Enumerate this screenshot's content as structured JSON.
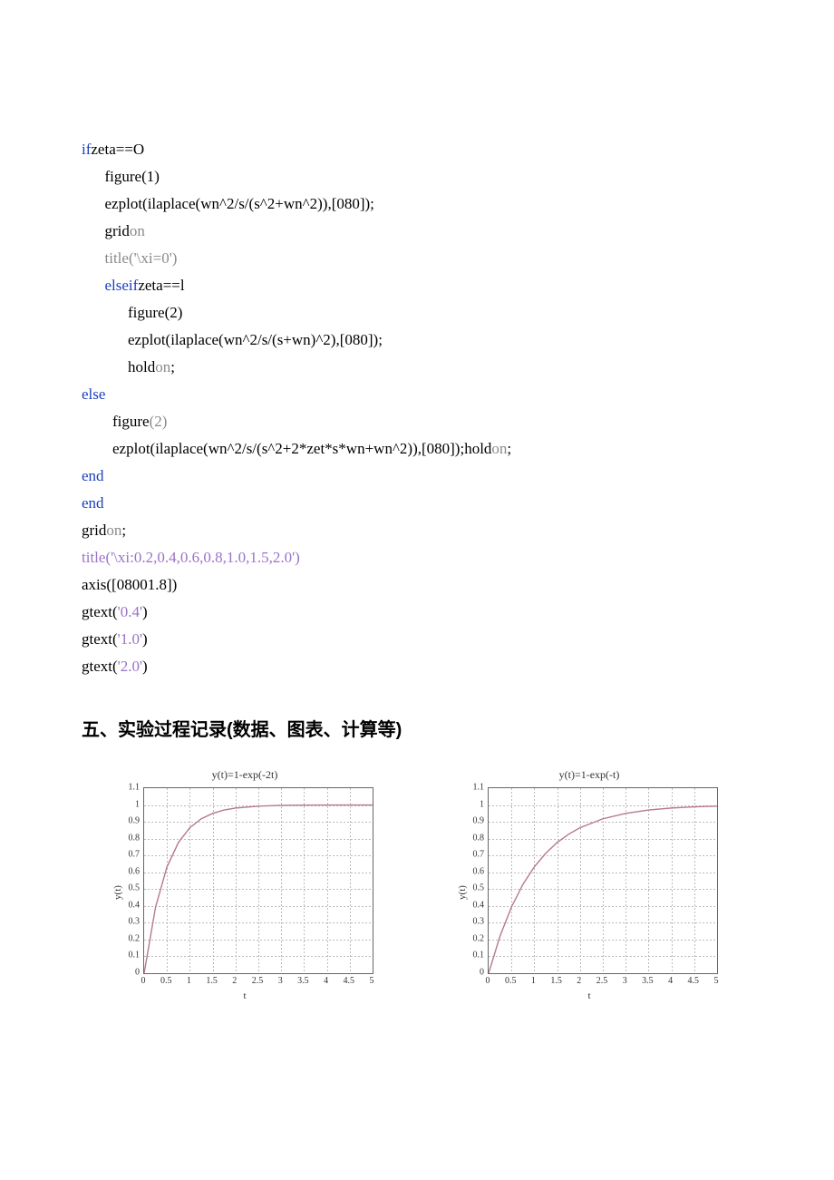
{
  "code": {
    "l1a": "if",
    "l1b": "zeta==O",
    "l2": "figure(1)",
    "l3": "ezplot(ilaplace(wn^2/s/(s^2+wn^2)),[080]);",
    "l4a": "grid",
    "l4b": "on",
    "l5a": "title(",
    "l5b": "'\\xi=0'",
    "l5c": ")",
    "l6a": "elseif",
    "l6b": "zeta==l",
    "l7": "figure(2)",
    "l8": "ezplot(ilaplace(wn^2/s/(s+wn)^2),[080]);",
    "l9a": "hold",
    "l9b": "on",
    "l9c": ";",
    "l10": "else",
    "l11a": "figure",
    "l11b": "(2)",
    "l12a": "ezplot(ilaplace(wn^2/s/(s^2+2*zet*s*wn+wn^2)),[080]);hold",
    "l12b": "on",
    "l12c": ";",
    "l13": "end",
    "l14": "end",
    "l15a": "grid",
    "l15b": "on",
    "l15c": ";",
    "l16a": "title(",
    "l16b": "'\\xi:0.2,0.4,0.6,0.8,1.0,1.5,2.0'",
    "l16c": ")",
    "l17": "axis([08001.8])",
    "l18a": "gtext(",
    "l18b": "'0.4'",
    "l18c": ")",
    "l19a": "gtext(",
    "l19b": "'1.0'",
    "l19c": ")",
    "l20a": "gtext(",
    "l20b": "'2.0'",
    "l20c": ")"
  },
  "heading": "五、实验过程记录(数据、图表、计算等)",
  "chart_data": [
    {
      "type": "line",
      "title": "y(t)=1-exp(-2t)",
      "xlabel": "t",
      "ylabel": "y(t)",
      "xlim": [
        0,
        5
      ],
      "ylim": [
        0,
        1.1
      ],
      "x_ticks": [
        "0",
        "0.5",
        "1",
        "1.5",
        "2",
        "2.5",
        "3",
        "3.5",
        "4",
        "4.5",
        "5"
      ],
      "y_ticks": [
        "0",
        "0.1",
        "0.2",
        "0.3",
        "0.4",
        "0.5",
        "0.6",
        "0.7",
        "0.8",
        "0.9",
        "1",
        "1.1"
      ],
      "series": [
        {
          "name": "y=1-exp(-2t)",
          "x": [
            0,
            0.25,
            0.5,
            0.75,
            1,
            1.25,
            1.5,
            1.75,
            2,
            2.5,
            3,
            3.5,
            4,
            4.5,
            5
          ],
          "y": [
            0,
            0.393,
            0.632,
            0.777,
            0.865,
            0.918,
            0.95,
            0.97,
            0.982,
            0.993,
            0.998,
            0.999,
            1,
            1,
            1
          ]
        }
      ]
    },
    {
      "type": "line",
      "title": "y(t)=1-exp(-t)",
      "xlabel": "t",
      "ylabel": "y(t)",
      "xlim": [
        0,
        5
      ],
      "ylim": [
        0,
        1.1
      ],
      "x_ticks": [
        "0",
        "0.5",
        "1",
        "1.5",
        "2",
        "2.5",
        "3",
        "3.5",
        "4",
        "4.5",
        "5"
      ],
      "y_ticks": [
        "0",
        "0.1",
        "0.2",
        "0.3",
        "0.4",
        "0.5",
        "0.6",
        "0.7",
        "0.8",
        "0.9",
        "1",
        "1.1"
      ],
      "series": [
        {
          "name": "y=1-exp(-t)",
          "x": [
            0,
            0.25,
            0.5,
            0.75,
            1,
            1.25,
            1.5,
            1.75,
            2,
            2.5,
            3,
            3.5,
            4,
            4.5,
            5
          ],
          "y": [
            0,
            0.221,
            0.393,
            0.528,
            0.632,
            0.713,
            0.777,
            0.826,
            0.865,
            0.918,
            0.95,
            0.97,
            0.982,
            0.989,
            0.993
          ]
        }
      ]
    }
  ]
}
